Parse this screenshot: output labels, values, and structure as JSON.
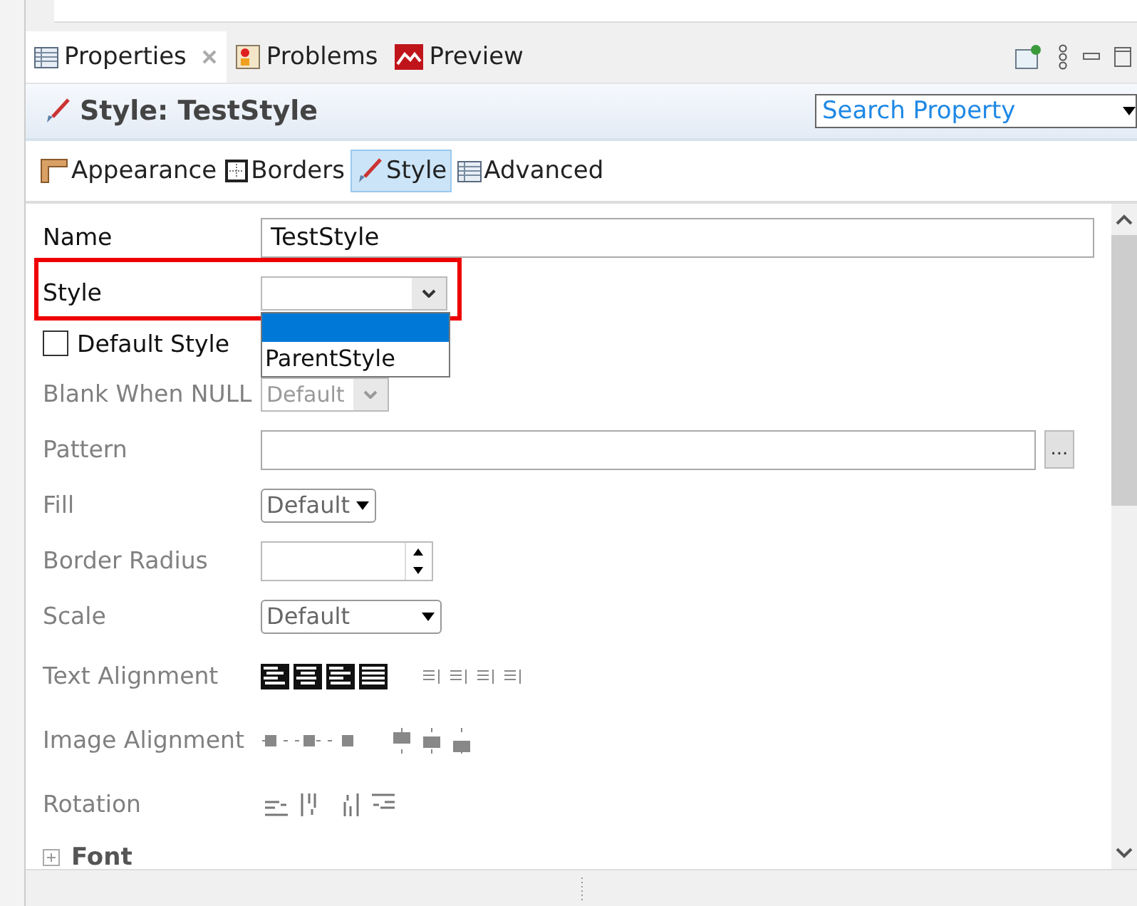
{
  "tabs": [
    {
      "label": "Properties",
      "selected": true,
      "closable": true,
      "kind": "table"
    },
    {
      "label": "Problems",
      "selected": false,
      "closable": false,
      "kind": "problems"
    },
    {
      "label": "Preview",
      "selected": false,
      "closable": false,
      "kind": "preview"
    }
  ],
  "header": {
    "title": "Style: TestStyle",
    "search": {
      "placeholder": "Search Property"
    }
  },
  "sections": [
    {
      "label": "Appearance",
      "selected": false,
      "kind": "ruler"
    },
    {
      "label": "Borders",
      "selected": false,
      "kind": "borders"
    },
    {
      "label": "Style",
      "selected": true,
      "kind": "brush"
    },
    {
      "label": "Advanced",
      "selected": false,
      "kind": "table"
    }
  ],
  "fields": [
    {
      "kind": "text",
      "label": "Name",
      "value": "TestStyle",
      "disabled": false
    },
    {
      "kind": "combo",
      "label": "Style",
      "disabled": false,
      "highlighted": true,
      "open": true,
      "blank_option_selected": true,
      "options": [
        {
          "label": "ParentStyle",
          "selected": false
        }
      ]
    },
    {
      "kind": "checkbox",
      "label": "Default Style",
      "checked": false,
      "disabled": false
    },
    {
      "kind": "combo",
      "label": "Blank When NULL",
      "value": "Default",
      "disabled": true
    },
    {
      "kind": "text_button",
      "label": "Pattern",
      "button": "...",
      "disabled": true
    },
    {
      "kind": "dropdown",
      "label": "Fill",
      "value": "Default",
      "disabled": true
    },
    {
      "kind": "spinner",
      "label": "Border Radius",
      "disabled": true
    },
    {
      "kind": "select",
      "label": "Scale",
      "value": "Default",
      "disabled": true
    },
    {
      "kind": "text_align",
      "label": "Text Alignment",
      "disabled": true
    },
    {
      "kind": "image_align",
      "label": "Image Alignment",
      "disabled": true
    },
    {
      "kind": "rotation",
      "label": "Rotation",
      "disabled": true
    }
  ],
  "font_section": {
    "label": "Font",
    "expanded": false
  }
}
